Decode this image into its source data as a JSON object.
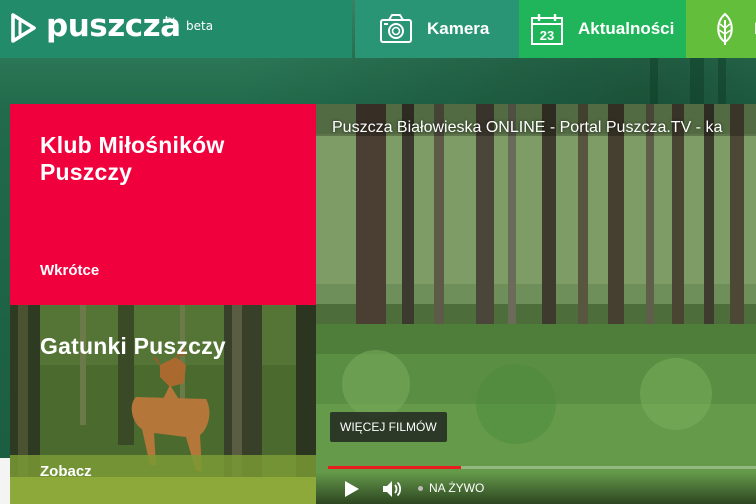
{
  "logo": {
    "name": "puszcza",
    "sup": "tv",
    "badge": "beta"
  },
  "nav": [
    {
      "label": "Kamera",
      "icon": "camera-icon"
    },
    {
      "label": "Aktualności",
      "icon": "calendar-icon",
      "icon_text": "23"
    },
    {
      "label": "P",
      "icon": "leaf-icon"
    }
  ],
  "tiles": {
    "club": {
      "title": "Klub Miłośników Puszczy",
      "link": "Wkrótce",
      "color": "#f0003c"
    },
    "species": {
      "title": "Gatunki Puszczy",
      "link": "Zobacz"
    }
  },
  "video": {
    "title": "Puszcza Białowieska ONLINE - Portal Puszcza.TV - ka",
    "more_button": "WIĘCEJ FILMÓW",
    "live_label": "NA ŻYWO",
    "progress_percent": 31,
    "progress_color": "#e81e1e"
  },
  "colors": {
    "logo_bg": "#228b69",
    "kamera_bg": "#2a9574",
    "aktualnosci_bg": "#20b45b",
    "p_bg": "#63bf3b"
  }
}
